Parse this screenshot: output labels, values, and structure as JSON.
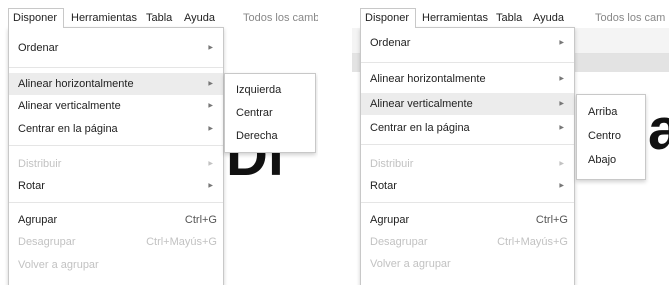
{
  "menubar": {
    "items": [
      "Disponer",
      "Herramientas",
      "Tabla",
      "Ayuda"
    ],
    "save_status_left": "Todos los camb",
    "save_status_right": "Todos los cam"
  },
  "arrange_menu": {
    "items": [
      {
        "label": "Ordenar",
        "submenu": true,
        "enabled": true
      },
      {
        "label": "Alinear horizontalmente",
        "submenu": true,
        "enabled": true
      },
      {
        "label": "Alinear verticalmente",
        "submenu": true,
        "enabled": true
      },
      {
        "label": "Centrar en la página",
        "submenu": true,
        "enabled": true
      },
      {
        "label": "Distribuir",
        "submenu": true,
        "enabled": false
      },
      {
        "label": "Rotar",
        "submenu": true,
        "enabled": true
      },
      {
        "label": "Agrupar",
        "shortcut": "Ctrl+G",
        "enabled": true
      },
      {
        "label": "Desagrupar",
        "shortcut": "Ctrl+Mayús+G",
        "enabled": false
      },
      {
        "label": "Volver a agrupar",
        "enabled": false
      }
    ]
  },
  "left_panel": {
    "highlighted_item": "Alinear horizontalmente",
    "submenu": [
      "Izquierda",
      "Centrar",
      "Derecha"
    ],
    "canvas_text": "Di"
  },
  "right_panel": {
    "highlighted_item": "Alinear verticalmente",
    "submenu": [
      "Arriba",
      "Centro",
      "Abajo"
    ],
    "canvas_text": "a"
  }
}
